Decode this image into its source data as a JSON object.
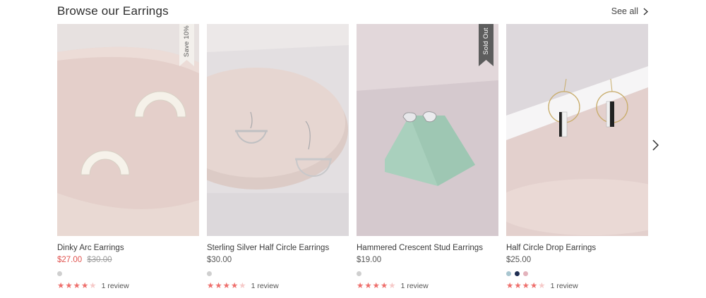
{
  "header": {
    "title": "Browse our Earrings",
    "see_all": "See all"
  },
  "products": [
    {
      "name": "Dinky Arc Earrings",
      "price": "$27.00",
      "original_price": "$30.00",
      "on_sale": true,
      "ribbon": "Save 10%",
      "ribbon_color": "#f3f0ec",
      "ribbon_text_color": "#5a5a5a",
      "swatches": [
        "#cfcfcf"
      ],
      "rating": 4,
      "reviews": "1 review"
    },
    {
      "name": "Sterling Silver Half Circle Earrings",
      "price": "$30.00",
      "swatches": [
        "#cfcfcf"
      ],
      "rating": 4,
      "reviews": "1 review"
    },
    {
      "name": "Hammered Crescent Stud Earrings",
      "price": "$19.00",
      "ribbon": "Sold Out",
      "ribbon_color": "#5d5d5d",
      "ribbon_text_color": "#ffffff",
      "swatches": [
        "#cfcfcf"
      ],
      "rating": 4,
      "reviews": "1 review"
    },
    {
      "name": "Half Circle Drop Earrings",
      "price": "$25.00",
      "swatches": [
        "#a9c6d0",
        "#1f2d52",
        "#e3b3bc"
      ],
      "rating": 4,
      "reviews": "1 review"
    }
  ],
  "colors": {
    "star": "#ee6f6c",
    "star_empty": "#f6c9c8",
    "sale": "#e0534f"
  },
  "icons": {
    "see_all": "chevron-right-icon",
    "carousel_next": "chevron-right-icon",
    "rating": "star-icon"
  }
}
